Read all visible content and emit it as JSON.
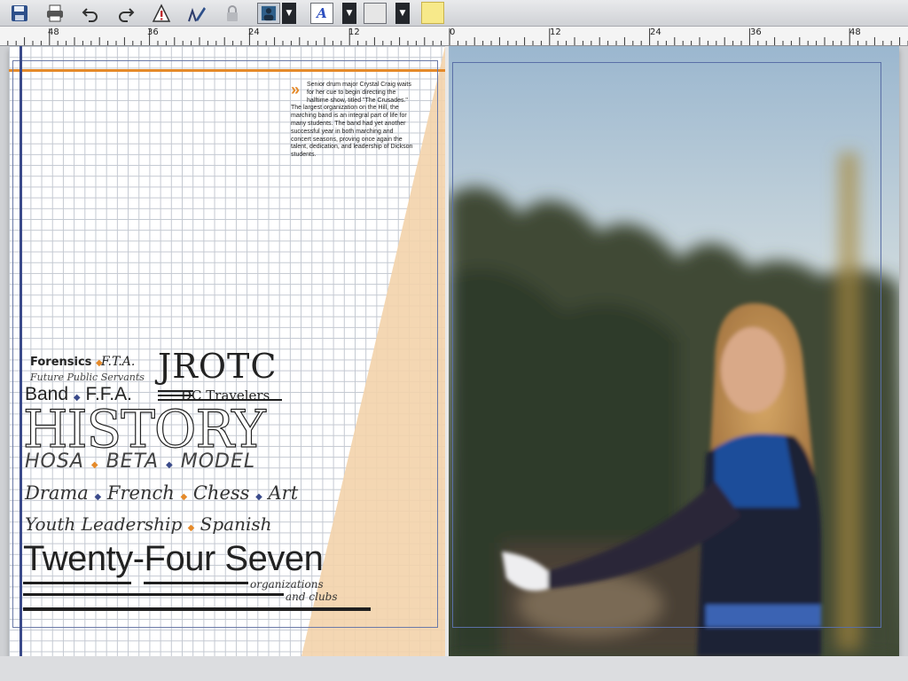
{
  "toolbar": {
    "buttons": [
      "save-icon",
      "print-icon",
      "undo-icon",
      "redo-icon",
      "spellcheck-icon",
      "pen-tool-icon",
      "lock-icon"
    ],
    "picture_color": "#2f5f8a",
    "text_color_glyph": "A",
    "note_color": "#f7e98a"
  },
  "ruler": {
    "labels": [
      "48",
      "36",
      "24",
      "12",
      "0",
      "12",
      "24",
      "36",
      "48"
    ]
  },
  "left_page": {
    "caption_lead": "Senior drum major Crystal Craig waits for her cue to begin directing the halftime show, titled \"The Crusades.\"",
    "caption_body": "The largest organization on the Hill, the marching band is an integral part of life for many students. The band had yet another successful year in both marching and concert seasons, proving once again the talent, dedication, and leadership of Dickson students.",
    "wordcloud": {
      "forensics": "Forensics",
      "fta": "F.T.A.",
      "jrotc": "JROTC",
      "future": "Future Public Servants",
      "band": "Band",
      "ffa": "F.F.A.",
      "dc_travelers": "DC Travelers",
      "history": "HISTORY",
      "hosa": "HOSA",
      "beta": "BETA",
      "model": "MODEL",
      "drama": "Drama",
      "french": "French",
      "chess": "Chess",
      "art": "Art",
      "youth": "Youth Leadership",
      "spanish": "Spanish",
      "title": "Twenty-Four Seven",
      "sub1": "organizations",
      "sub2": "and clubs"
    },
    "accent_color": "#e58a2a",
    "blue_color": "#3a4a8a",
    "peach_color": "#f3d3ab"
  }
}
